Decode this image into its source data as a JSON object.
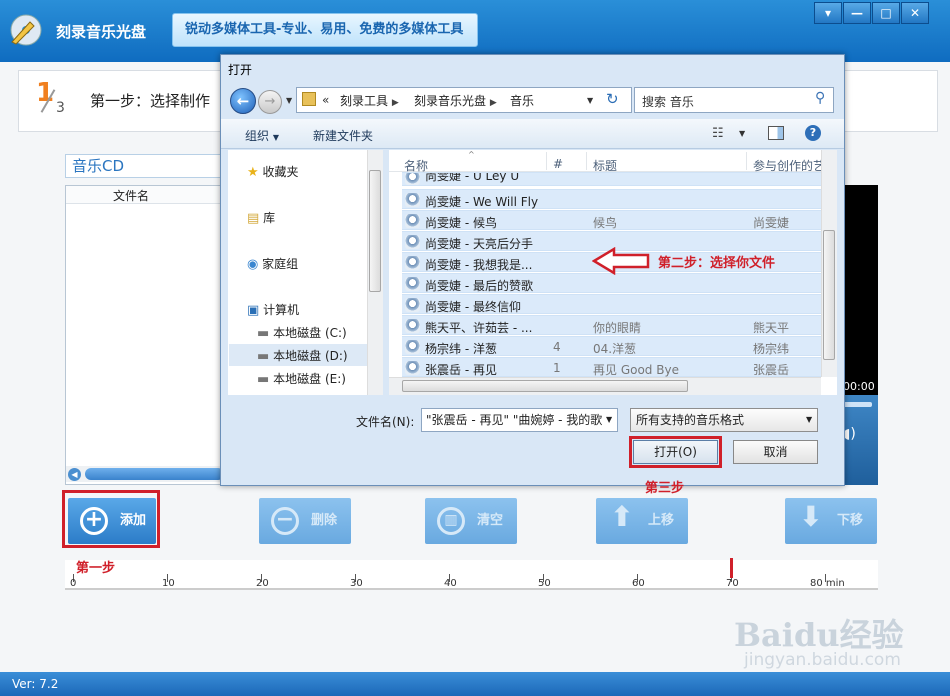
{
  "app": {
    "title": "刻录音乐光盘",
    "slogan": "锐动多媒体工具-专业、易用、免费的多媒体工具",
    "version": "Ver: 7.2",
    "window_buttons": [
      "▾",
      "—",
      "□",
      "✕"
    ]
  },
  "step": {
    "numerator": "1",
    "denominator": "3",
    "text": "第一步：选择制作"
  },
  "disc": {
    "label": "音乐CD",
    "column_filename": "文件名"
  },
  "player": {
    "time": "00:00"
  },
  "buttons": {
    "add": "添加",
    "delete": "删除",
    "clear": "清空",
    "up": "上移",
    "down": "下移"
  },
  "ruler": {
    "labels": [
      "0",
      "10",
      "20",
      "30",
      "40",
      "50",
      "60",
      "70",
      "80 min"
    ]
  },
  "annotations": {
    "step1": "第一步",
    "step2": "第二步：选择你文件",
    "step3": "第三步"
  },
  "dialog": {
    "title": "打开",
    "breadcrumb": [
      "刻录工具",
      "刻录音乐光盘",
      "音乐"
    ],
    "breadcrumb_prefix": "«",
    "search_placeholder": "搜索 音乐",
    "toolbar": {
      "organize": "组织",
      "new_folder": "新建文件夹"
    },
    "nav": {
      "favorites": "收藏夹",
      "libraries": "库",
      "homegroup": "家庭组",
      "computer": "计算机",
      "drive_c": "本地磁盘 (C:)",
      "drive_d": "本地磁盘 (D:)",
      "drive_e": "本地磁盘 (E:)"
    },
    "columns": {
      "name": "名称",
      "number": "#",
      "title": "标题",
      "artist": "参与创作的艺"
    },
    "files": [
      {
        "name": "尚雯婕 - U Ley U",
        "num": "",
        "title": "",
        "artist": ""
      },
      {
        "name": "尚雯婕 - We Will Fly",
        "num": "",
        "title": "",
        "artist": ""
      },
      {
        "name": "尚雯婕 - 候鸟",
        "num": "",
        "title": "候鸟",
        "artist": "尚雯婕"
      },
      {
        "name": "尚雯婕 - 天亮后分手",
        "num": "",
        "title": "",
        "artist": ""
      },
      {
        "name": "尚雯婕 - 我想我是...",
        "num": "",
        "title": "",
        "artist": ""
      },
      {
        "name": "尚雯婕 - 最后的赞歌",
        "num": "",
        "title": "",
        "artist": ""
      },
      {
        "name": "尚雯婕 - 最终信仰",
        "num": "",
        "title": "",
        "artist": ""
      },
      {
        "name": "熊天平、许茹芸 - ...",
        "num": "",
        "title": "你的眼睛",
        "artist": "熊天平"
      },
      {
        "name": "杨宗纬 - 洋葱",
        "num": "4",
        "title": "04.洋葱",
        "artist": "杨宗纬"
      },
      {
        "name": "张震岳 - 再见",
        "num": "1",
        "title": "再见 Good Bye",
        "artist": "张震岳"
      }
    ],
    "filename_label": "文件名(N):",
    "filename_value": "\"张震岳 - 再见\" \"曲婉婷 - 我的歌",
    "filetype": "所有支持的音乐格式",
    "open": "打开(O)",
    "cancel": "取消"
  },
  "watermark": {
    "brand": "Baidu经验",
    "url": "jingyan.baidu.com"
  },
  "colors": {
    "accent": "#1f78c8",
    "highlight": "#d0202a"
  }
}
